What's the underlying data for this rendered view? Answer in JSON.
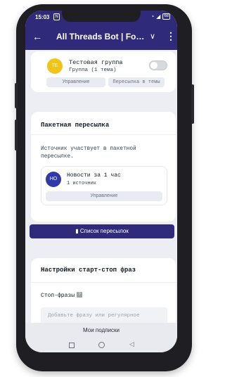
{
  "status_bar": {
    "time": "15:03",
    "n_icon": "N",
    "battery": "68"
  },
  "app_bar": {
    "back_icon": "arrow-left-icon",
    "title": "All Threads Bot | Fo…",
    "chevron_icon": "chevron-down-icon",
    "more_icon": "more-vertical-icon"
  },
  "group_card": {
    "avatar": "TE",
    "name": "Тестовая группа",
    "subtitle": "Группа (1 тема)",
    "toggle_on": false,
    "btn_manage": "Управление",
    "btn_forward_topic": "Пересылка в темы"
  },
  "batch_card": {
    "title": "Пакетная пересылка",
    "description": "Источник участвует в пакетной пересылке.",
    "item": {
      "avatar": "НО",
      "name": "Новости за 1 час",
      "sources": "1 источник",
      "btn_manage": "Управление"
    }
  },
  "list_button": {
    "label": "Список пересылок"
  },
  "stopstart_card": {
    "title": "Настройки старт-стоп фраз",
    "stop_label": "Стоп-фразы",
    "input_placeholder": "Добавьте фразу или регулярное"
  },
  "bottom_nav": {
    "label": "Мои подписки"
  },
  "colors": {
    "primary": "#2f2a7a",
    "avatar_yellow": "#f2c318",
    "avatar_blue": "#2f3aa8"
  }
}
